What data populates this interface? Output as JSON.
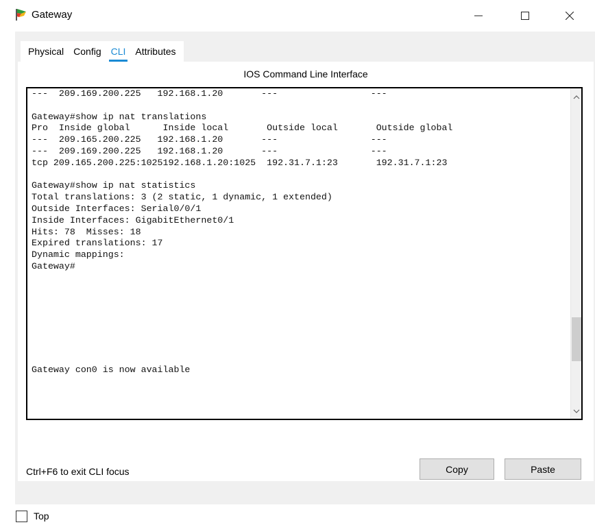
{
  "window": {
    "title": "Gateway",
    "icon": "packet-tracer-router-icon",
    "minimize_glyph": "—",
    "maximize_glyph": "☐",
    "close_glyph": "✕"
  },
  "tabs": [
    {
      "label": "Physical",
      "active": false
    },
    {
      "label": "Config",
      "active": false
    },
    {
      "label": "CLI",
      "active": true
    },
    {
      "label": "Attributes",
      "active": false
    }
  ],
  "cli": {
    "title": "IOS Command Line Interface",
    "lines": [
      "---  209.169.200.225   192.168.1.20       ---                 ---",
      "",
      "Gateway#show ip nat translations",
      "Pro  Inside global      Inside local       Outside local       Outside global",
      "---  209.165.200.225   192.168.1.20       ---                 ---",
      "---  209.169.200.225   192.168.1.20       ---                 ---",
      "tcp 209.165.200.225:1025192.168.1.20:1025  192.31.7.1:23       192.31.7.1:23",
      "",
      "Gateway#show ip nat statistics",
      "Total translations: 3 (2 static, 1 dynamic, 1 extended)",
      "Outside Interfaces: Serial0/0/1",
      "Inside Interfaces: GigabitEthernet0/1",
      "Hits: 78  Misses: 18",
      "Expired translations: 17",
      "Dynamic mappings:",
      "Gateway#",
      "",
      "",
      "",
      "",
      "",
      "",
      "",
      "",
      "Gateway con0 is now available"
    ],
    "scroll_up_glyph": "⌃",
    "scroll_down_glyph": "⌄"
  },
  "footer": {
    "hint": "Ctrl+F6 to exit CLI focus",
    "copy_label": "Copy",
    "paste_label": "Paste"
  },
  "top_option": {
    "label": "Top",
    "checked": false
  }
}
